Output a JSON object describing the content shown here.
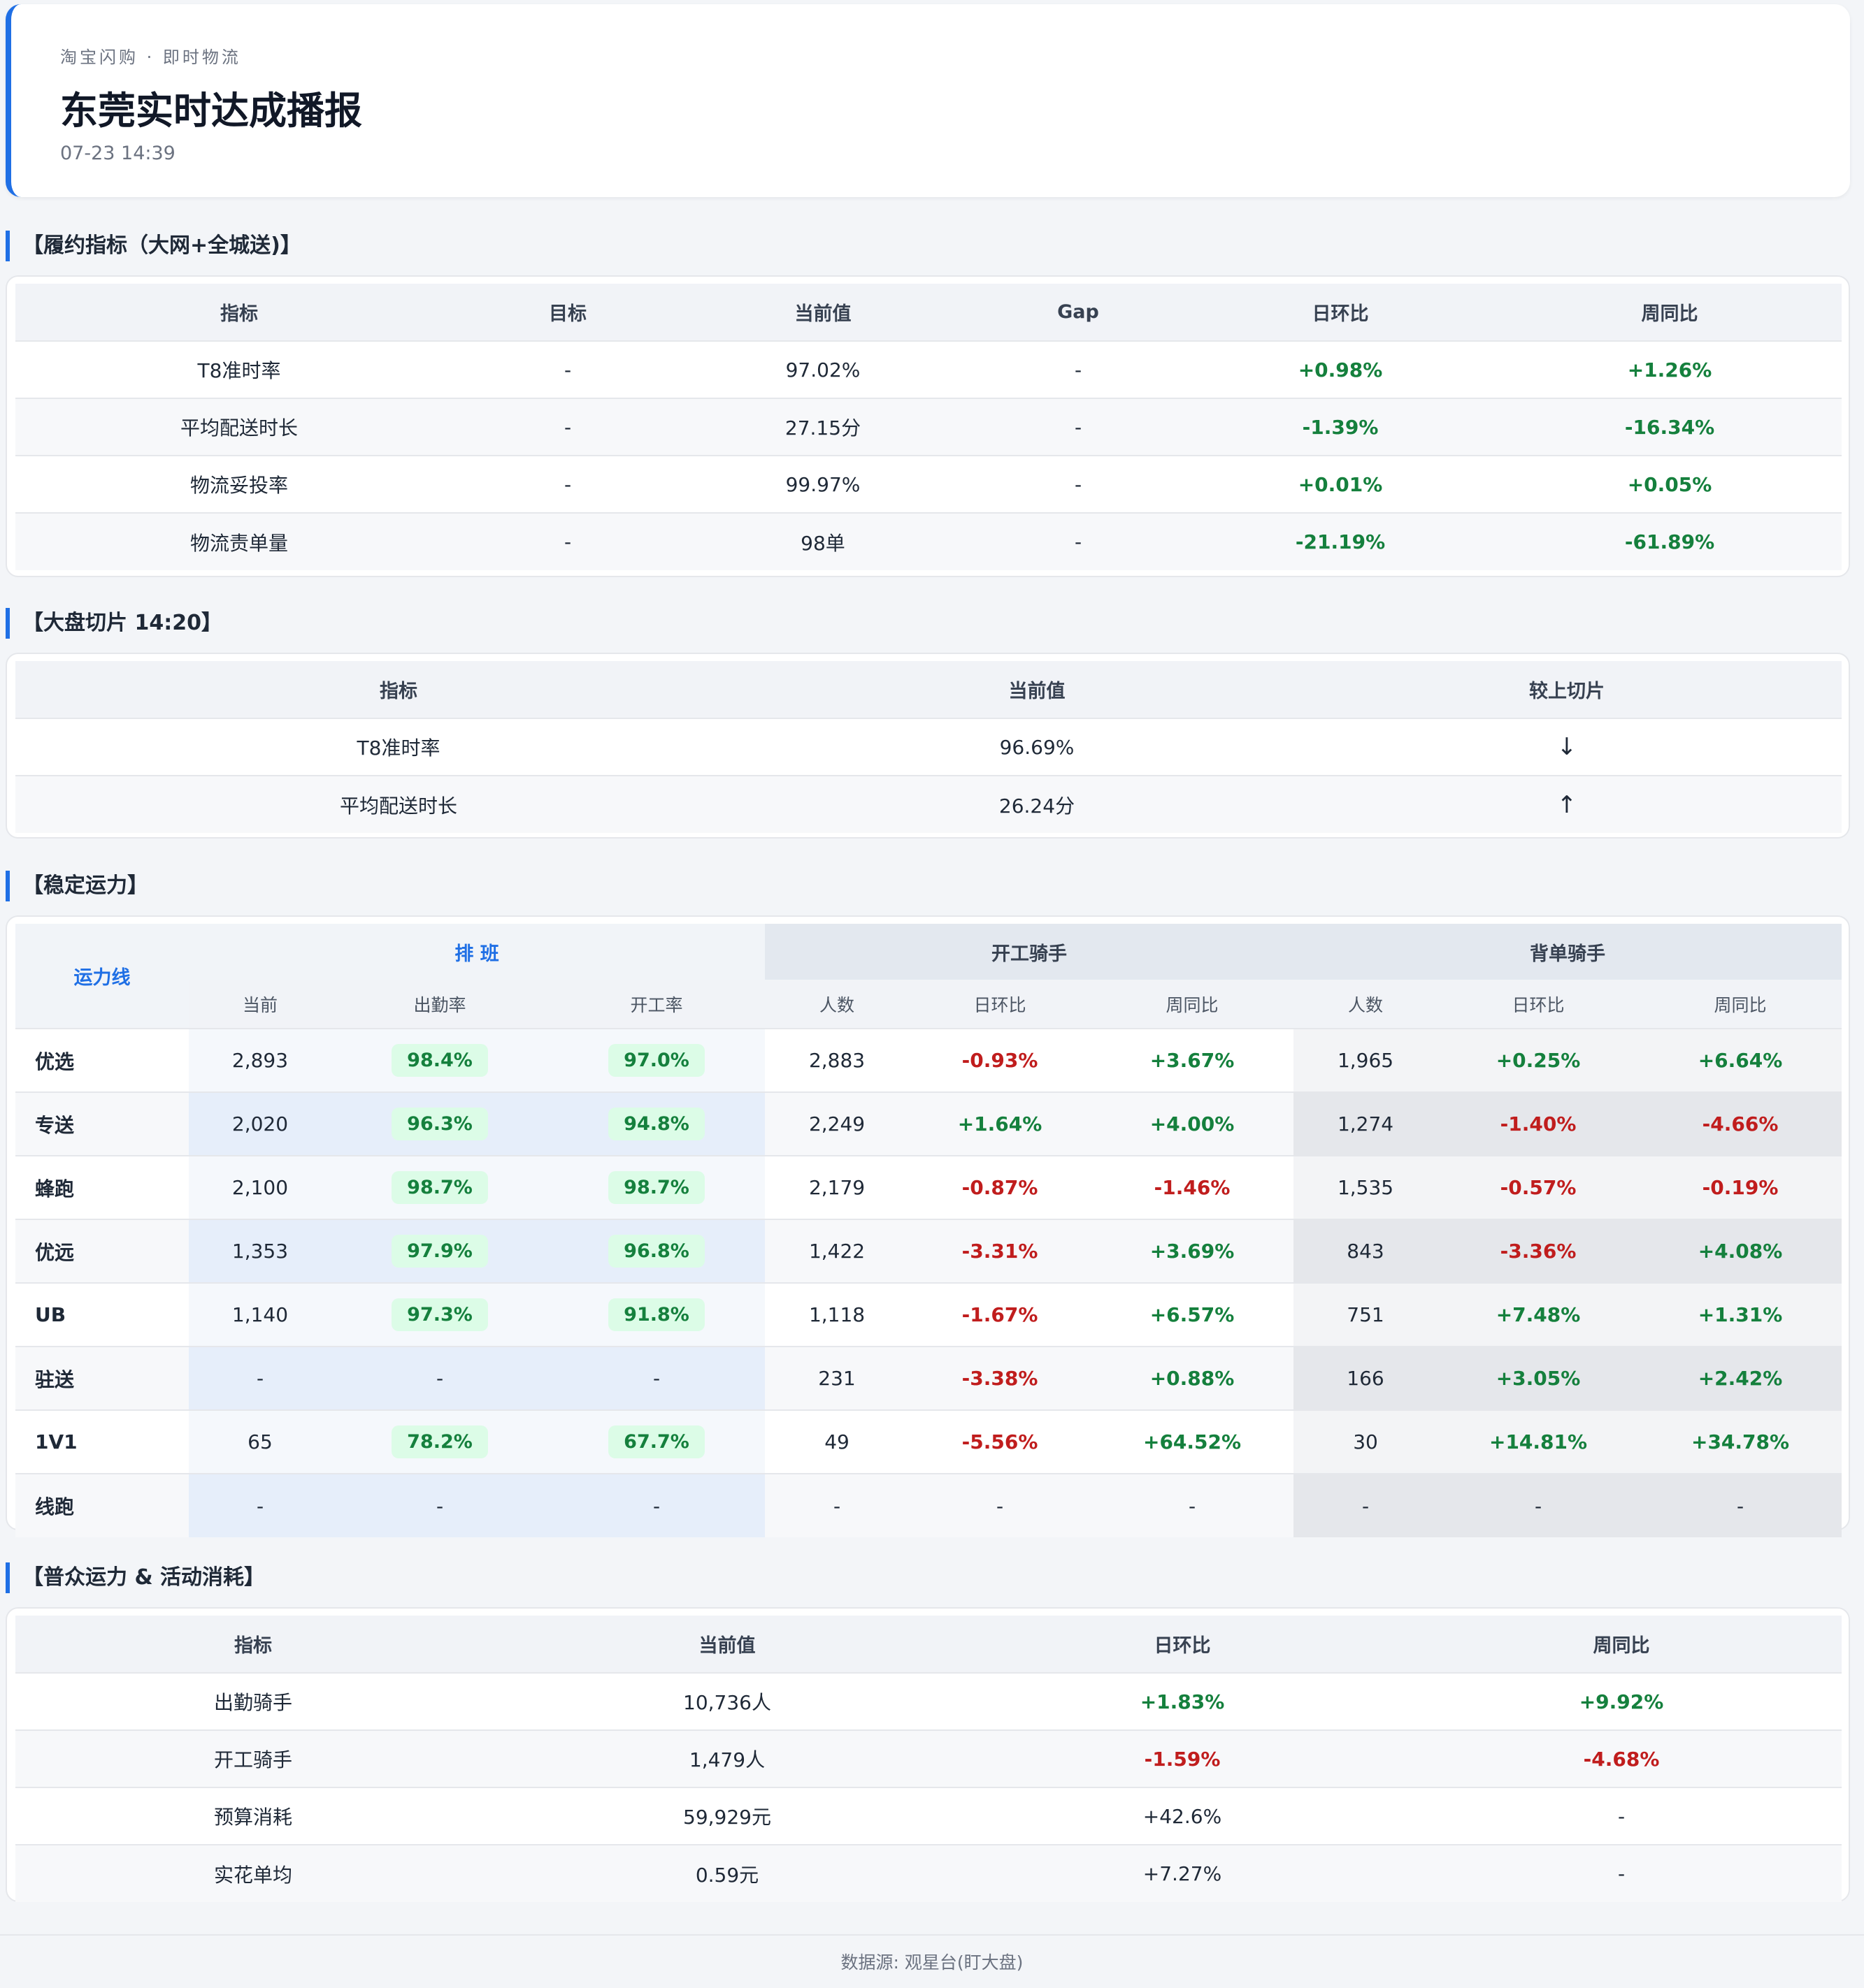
{
  "header": {
    "crumb": "淘宝闪购 · 即时物流",
    "title": "东莞实时达成播报",
    "time": "07-23 14:39"
  },
  "fulfillment": {
    "title": "【履约指标（大网+全城送)】",
    "headers": [
      "指标",
      "目标",
      "当前值",
      "Gap",
      "日环比",
      "周同比"
    ],
    "rows": [
      {
        "name": "T8准时率",
        "target": "-",
        "value": "97.02%",
        "gap": "-",
        "dod": "+0.98%",
        "yoy": "+1.26%"
      },
      {
        "name": "平均配送时长",
        "target": "-",
        "value": "27.15分",
        "gap": "-",
        "dod": "-1.39%",
        "yoy": "-16.34%"
      },
      {
        "name": "物流妥投率",
        "target": "-",
        "value": "99.97%",
        "gap": "-",
        "dod": "+0.01%",
        "yoy": "+0.05%"
      },
      {
        "name": "物流责单量",
        "target": "-",
        "value": "98单",
        "gap": "-",
        "dod": "-21.19%",
        "yoy": "-61.89%"
      }
    ]
  },
  "slice": {
    "title": "【大盘切片 14:20】",
    "headers": [
      "指标",
      "当前值",
      "较上切片"
    ],
    "rows": [
      {
        "name": "T8准时率",
        "value": "96.69%",
        "trend": "↓"
      },
      {
        "name": "平均配送时长",
        "value": "26.24分",
        "trend": "↑"
      }
    ]
  },
  "capacity": {
    "title": "【稳定运力】",
    "line_header": "运力线",
    "groups": [
      "排 班",
      "开工骑手",
      "背单骑手"
    ],
    "sub_headers": [
      "当前",
      "出勤率",
      "开工率",
      "人数",
      "日环比",
      "周同比",
      "人数",
      "日环比",
      "周同比"
    ],
    "rows": [
      {
        "name": "优选",
        "pb_cur": "2,893",
        "pb_att": "98.4%",
        "pb_work": "97.0%",
        "kg_n": "2,883",
        "kg_dod": "-0.93%",
        "kg_yoy": "+3.67%",
        "bd_n": "1,965",
        "bd_dod": "+0.25%",
        "bd_yoy": "+6.64%"
      },
      {
        "name": "专送",
        "pb_cur": "2,020",
        "pb_att": "96.3%",
        "pb_work": "94.8%",
        "kg_n": "2,249",
        "kg_dod": "+1.64%",
        "kg_yoy": "+4.00%",
        "bd_n": "1,274",
        "bd_dod": "-1.40%",
        "bd_yoy": "-4.66%"
      },
      {
        "name": "蜂跑",
        "pb_cur": "2,100",
        "pb_att": "98.7%",
        "pb_work": "98.7%",
        "kg_n": "2,179",
        "kg_dod": "-0.87%",
        "kg_yoy": "-1.46%",
        "bd_n": "1,535",
        "bd_dod": "-0.57%",
        "bd_yoy": "-0.19%"
      },
      {
        "name": "优远",
        "pb_cur": "1,353",
        "pb_att": "97.9%",
        "pb_work": "96.8%",
        "kg_n": "1,422",
        "kg_dod": "-3.31%",
        "kg_yoy": "+3.69%",
        "bd_n": "843",
        "bd_dod": "-3.36%",
        "bd_yoy": "+4.08%"
      },
      {
        "name": "UB",
        "pb_cur": "1,140",
        "pb_att": "97.3%",
        "pb_work": "91.8%",
        "kg_n": "1,118",
        "kg_dod": "-1.67%",
        "kg_yoy": "+6.57%",
        "bd_n": "751",
        "bd_dod": "+7.48%",
        "bd_yoy": "+1.31%"
      },
      {
        "name": "驻送",
        "pb_cur": "-",
        "pb_att": "-",
        "pb_work": "-",
        "kg_n": "231",
        "kg_dod": "-3.38%",
        "kg_yoy": "+0.88%",
        "bd_n": "166",
        "bd_dod": "+3.05%",
        "bd_yoy": "+2.42%"
      },
      {
        "name": "1V1",
        "pb_cur": "65",
        "pb_att": "78.2%",
        "pb_work": "67.7%",
        "kg_n": "49",
        "kg_dod": "-5.56%",
        "kg_yoy": "+64.52%",
        "bd_n": "30",
        "bd_dod": "+14.81%",
        "bd_yoy": "+34.78%"
      },
      {
        "name": "线跑",
        "pb_cur": "-",
        "pb_att": "-",
        "pb_work": "-",
        "kg_n": "-",
        "kg_dod": "-",
        "kg_yoy": "-",
        "bd_n": "-",
        "bd_dod": "-",
        "bd_yoy": "-"
      }
    ]
  },
  "crowd": {
    "title": "【普众运力 & 活动消耗】",
    "headers": [
      "指标",
      "当前值",
      "日环比",
      "周同比"
    ],
    "rows": [
      {
        "name": "出勤骑手",
        "value": "10,736人",
        "dod": "+1.83%",
        "yoy": "+9.92%"
      },
      {
        "name": "开工骑手",
        "value": "1,479人",
        "dod": "-1.59%",
        "yoy": "-4.68%"
      },
      {
        "name": "预算消耗",
        "value": "59,929元",
        "dod": "+42.6%",
        "yoy": "-"
      },
      {
        "name": "实花单均",
        "value": "0.59元",
        "dod": "+7.27%",
        "yoy": "-"
      }
    ]
  },
  "footer": {
    "source": "数据源: 观星台(盯大盘)"
  },
  "colors": {
    "accent": "#1f6fe5",
    "positive": "#15803d",
    "negative": "#c01d1d",
    "pill_bg": "#dcfce7"
  }
}
